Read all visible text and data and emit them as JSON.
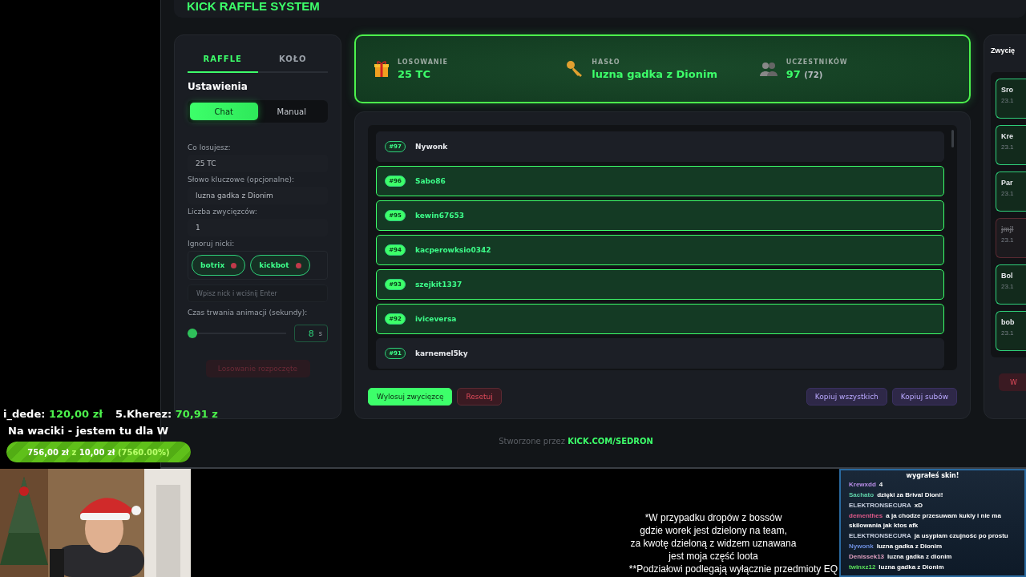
{
  "stream_overlay": {
    "donations": [
      {
        "name": "i_dede:",
        "amount": "120,00 zł"
      },
      {
        "name": "5.Kherez:",
        "amount": "70,91 z"
      }
    ],
    "goal_title": "Na waciki - jestem tu dla W",
    "goal": {
      "current": "756,00 zł",
      "separator": "z",
      "target": "10,00 zł",
      "percent": "(7560.00%)",
      "level": 1
    }
  },
  "app": {
    "title": "KICK RAFFLE SYSTEM",
    "tabs": [
      {
        "label": "RAFFLE",
        "selected": true
      },
      {
        "label": "KOŁO",
        "selected": false
      }
    ],
    "settings": {
      "heading": "Ustawienia",
      "modes": [
        {
          "label": "Chat",
          "selected": true
        },
        {
          "label": "Manual",
          "selected": false
        }
      ],
      "fields": [
        {
          "label": "Co losujesz:",
          "value": "25 TC"
        },
        {
          "label": "Słowo kluczowe (opcjonalne):",
          "value": "luzna gadka z Dionim"
        },
        {
          "label": "Liczba zwycięzców:",
          "value": "1"
        }
      ],
      "ignore_label": "Ignoruj nicki:",
      "ignored": [
        "botrix",
        "kickbot"
      ],
      "ignore_placeholder": "Wpisz nick i wciśnij Enter",
      "duration_label": "Czas trwania animacji (sekundy):",
      "duration": {
        "level": 0.08,
        "value": "8",
        "unit": "s"
      },
      "start_button": {
        "label": "Losowanie rozpoczęte",
        "disabled": true
      }
    },
    "summary": [
      {
        "kind": "gift",
        "label": "LOSOWANIE",
        "value": "25 TC"
      },
      {
        "kind": "key",
        "label": "HASŁO",
        "value": "luzna gadka z Dionim"
      },
      {
        "kind": "people",
        "label": "UCZESTNIKÓW",
        "value": "97",
        "extra": "(72)"
      }
    ],
    "participants": [
      {
        "number": "#97",
        "name": "Nywonk",
        "highlighted": false
      },
      {
        "number": "#96",
        "name": "Sabo86",
        "highlighted": true
      },
      {
        "number": "#95",
        "name": "kewin67653",
        "highlighted": true
      },
      {
        "number": "#94",
        "name": "kacperowksio0342",
        "highlighted": true
      },
      {
        "number": "#93",
        "name": "szejkit1337",
        "highlighted": true
      },
      {
        "number": "#92",
        "name": "iviceversa",
        "highlighted": true
      },
      {
        "number": "#91",
        "name": "karnemel5ky",
        "highlighted": false
      }
    ],
    "actions": [
      {
        "kind": "primary",
        "label": "Wylosuj zwycięzcę"
      },
      {
        "kind": "danger",
        "label": "Resetuj"
      },
      {
        "kind": "spacer"
      },
      {
        "kind": "secondary",
        "label": "Kopiuj wszystkich"
      },
      {
        "kind": "secondary",
        "label": "Kopiuj subów"
      }
    ],
    "winners_title": "Zwycię",
    "winners": [
      {
        "name": "Sro",
        "date": "23.1",
        "lost": false
      },
      {
        "name": "Kre",
        "date": "23.1",
        "lost": false
      },
      {
        "name": "Par",
        "date": "23.1",
        "lost": false
      },
      {
        "name": "jmjl",
        "date": "23.1",
        "lost": true
      },
      {
        "name": "Bol",
        "date": "23.1",
        "lost": false
      },
      {
        "name": "bob",
        "date": "23.1",
        "lost": false
      }
    ],
    "winners_button": "W",
    "footer": {
      "text": "Stworzone przez",
      "link": "KICK.COM/SEDRON"
    }
  },
  "notice": [
    "*W przypadku dropów z bossów",
    "gdzie worek jest dzielony na team,",
    "za kwotę dzieloną z widzem uznawana",
    "jest moja część loota",
    "**Podziałowi podlegają wyłącznie przedmioty EQ"
  ],
  "chat": {
    "header": "wygrałeś skin!",
    "messages": [
      {
        "user": "Krewxdd",
        "color": "#b98ee8",
        "text": "4"
      },
      {
        "user": "Sachato",
        "color": "#5fd0a8",
        "text": "dzięki za Brival Dioni!"
      },
      {
        "user": "ELEKTRONSECURA",
        "color": "#c8d0e0",
        "text": "xD"
      },
      {
        "user": "dementhes",
        "color": "#e05a8a",
        "text": "a ja chodze przesuwam kukly i nie ma skilowania jak ktos afk"
      },
      {
        "user": "ELEKTRONSECURA",
        "color": "#c8d0e0",
        "text": "ja usypiam czujnośc po prostu"
      },
      {
        "user": "Nywonk",
        "color": "#6d8fe0",
        "text": "luzna gadka z Dionim"
      },
      {
        "user": "Denissek13",
        "color": "#e0a0c0",
        "text": "luzna gadka z dionim"
      },
      {
        "user": "twinxz12",
        "color": "#5be05b",
        "text": "luzna gadka z Dionim"
      }
    ]
  }
}
